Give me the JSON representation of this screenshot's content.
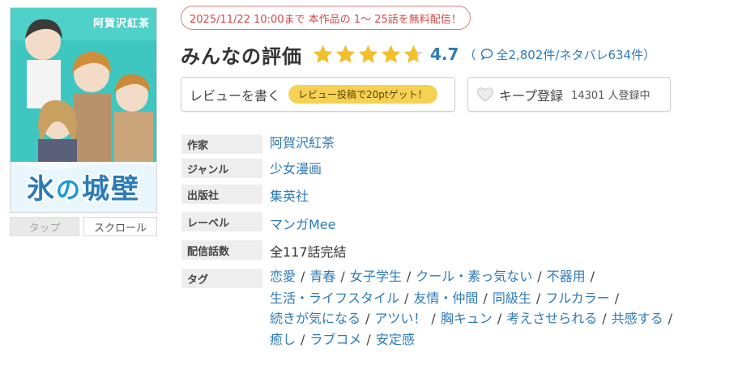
{
  "cover": {
    "author_text": "阿賀沢紅茶",
    "title_left": "氷",
    "title_no": "の",
    "title_right": "城壁"
  },
  "view_modes": {
    "tap": "タップ",
    "scroll": "スクロール"
  },
  "notice": "2025/11/22 10:00まで 本作品の 1～ 25話を無料配信！",
  "rating": {
    "title": "みんなの評価",
    "score": "4.7",
    "value": 4.7,
    "max": 5,
    "counts_open": "（",
    "counts_text": "全2,802件/ネタバレ634件",
    "counts_close": "）",
    "star_color": "#f2c02c",
    "star_empty_color": "#d9d9d9"
  },
  "review_button": {
    "label": "レビューを書く",
    "badge": "レビュー投稿で20ptゲット！"
  },
  "keep_button": {
    "label": "キープ登録",
    "count": "14301 人登録中"
  },
  "info": {
    "author": {
      "label": "作家",
      "value": "阿賀沢紅茶"
    },
    "genre": {
      "label": "ジャンル",
      "value": "少女漫画"
    },
    "publisher": {
      "label": "出版社",
      "value": "集英社"
    },
    "label": {
      "label": "レーベル",
      "value": "マンガMee"
    },
    "episodes": {
      "label": "配信話数",
      "value": "全117話完結"
    },
    "tags": {
      "label": "タグ",
      "separator": "/",
      "lines": [
        [
          "恋愛",
          "青春",
          "女子学生",
          "クール・素っ気ない",
          "不器用"
        ],
        [
          "生活・ライフスタイル",
          "友情・仲間",
          "同級生",
          "フルカラー"
        ],
        [
          "続きが気になる",
          "アツい！",
          "胸キュン",
          "考えさせられる",
          "共感する"
        ],
        [
          "癒し",
          "ラブコメ",
          "安定感"
        ]
      ]
    }
  },
  "colors": {
    "accent": "#2e7ab8",
    "notice": "#d84848",
    "badge": "#f5d254"
  }
}
